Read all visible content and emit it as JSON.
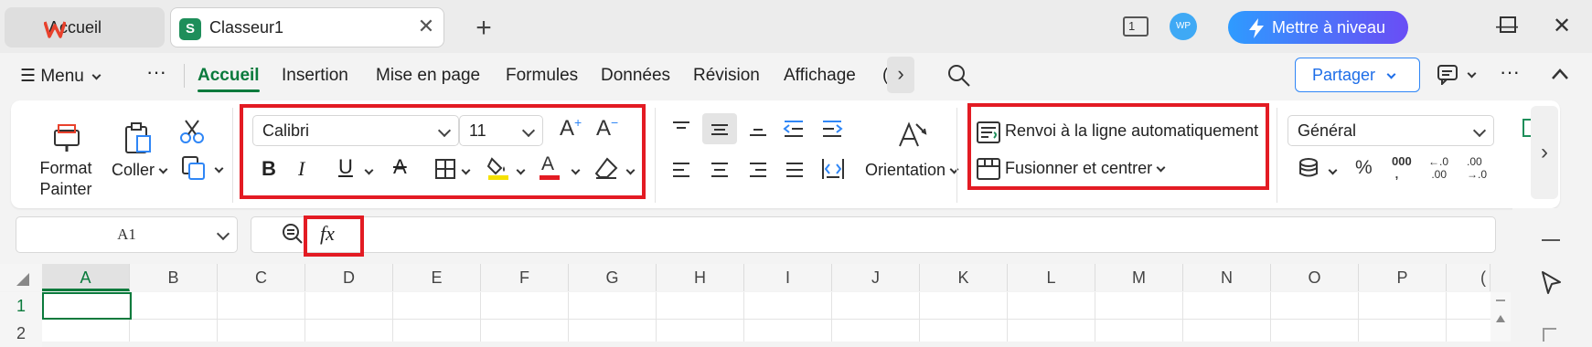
{
  "tabs": {
    "home_label": "Accueil",
    "doc_label": "Classeur1",
    "doc_icon": "S"
  },
  "header": {
    "page_count": "1",
    "avatar": "WP",
    "upgrade_label": "Mettre à niveau"
  },
  "menu": {
    "menu_label": "Menu",
    "items": [
      "Accueil",
      "Insertion",
      "Mise en page",
      "Formules",
      "Données",
      "Révision",
      "Affichage"
    ],
    "partial": "(",
    "share_label": "Partager"
  },
  "ribbon": {
    "format_painter_line1": "Format",
    "format_painter_line2": "Painter",
    "paste_label": "Coller",
    "font_name": "Calibri",
    "font_size": "11",
    "orientation_label": "Orientation",
    "wrap_label": "Renvoi à la ligne automatiquement",
    "merge_label": "Fusionner et centrer",
    "number_format": "Général"
  },
  "formula_bar": {
    "cell_ref": "A1",
    "fx_label": "fx"
  },
  "sheet": {
    "columns": [
      "A",
      "B",
      "C",
      "D",
      "E",
      "F",
      "G",
      "H",
      "I",
      "J",
      "K",
      "L",
      "M",
      "N",
      "O",
      "P",
      "("
    ],
    "rows": [
      "1",
      "2"
    ]
  },
  "colors": {
    "accent_green": "#0a7a3c",
    "highlight_red": "#e31b23",
    "share_blue": "#2f86f6"
  }
}
